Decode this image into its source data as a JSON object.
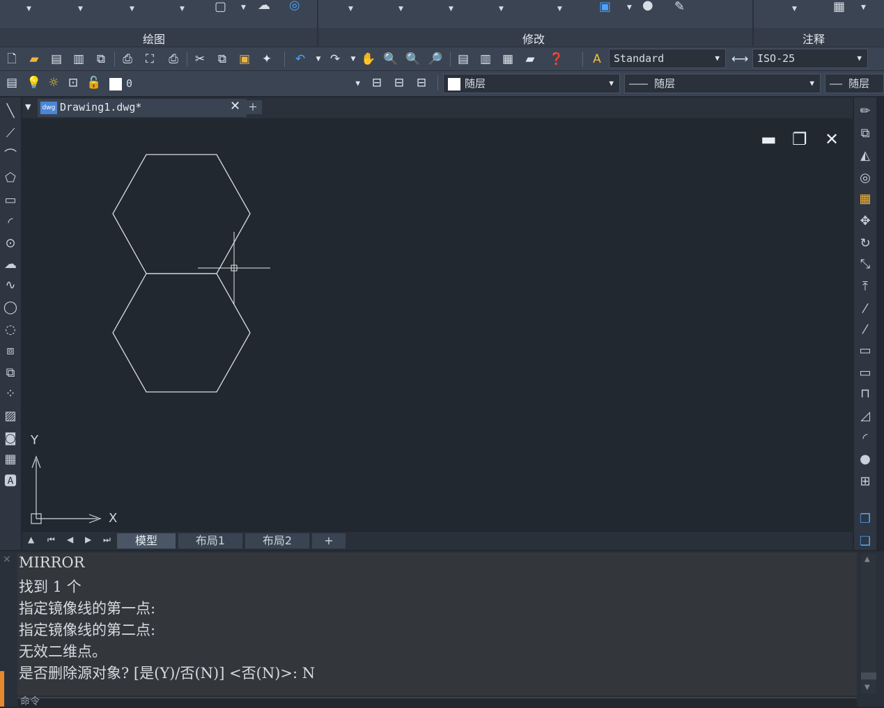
{
  "ribbon": {
    "panels": [
      "绘图",
      "修改",
      "注释"
    ]
  },
  "toolbar1": {
    "text_style": "Standard",
    "dim_style": "ISO-25"
  },
  "toolbar2": {
    "layer": "0",
    "color": "随层",
    "linetype": "随层",
    "lineweight": "随层"
  },
  "document_tab": {
    "title": "Drawing1.dwg*",
    "icon_text": "dwg"
  },
  "ucs": {
    "x_label": "X",
    "y_label": "Y"
  },
  "layout_tabs": [
    "模型",
    "布局1",
    "布局2",
    "+"
  ],
  "command_history": [
    "MIRROR",
    "找到 1 个",
    "指定镜像线的第一点:",
    "指定镜像线的第二点:",
    "无效二维点。",
    "是否删除源对象? [是(Y)/否(N)] <否(N)>: N"
  ],
  "command_prompt": "命令",
  "colors": {
    "ribbon_bg": "#3b4453",
    "canvas_bg": "#212830",
    "command_bg": "#33373c",
    "active_tab": "#4a5566"
  }
}
